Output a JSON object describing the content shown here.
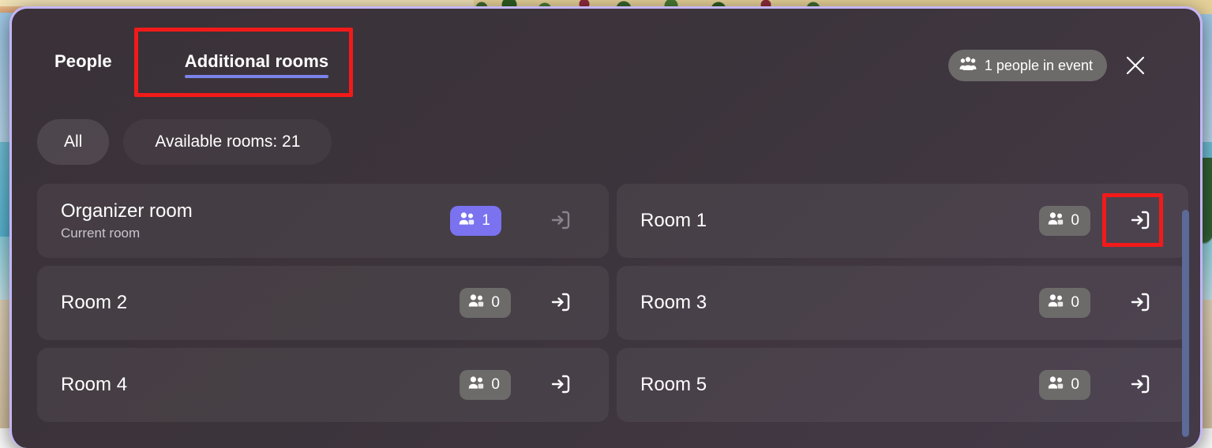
{
  "panel": {
    "accent_color": "#7b83eb",
    "badge_accent_color": "#7a72ef",
    "border_color": "#c4b5f5",
    "annotation_color": "#f21a1a"
  },
  "header": {
    "tabs": [
      {
        "label": "People",
        "selected": false
      },
      {
        "label": "Additional rooms",
        "selected": true
      }
    ],
    "event_count": {
      "icon": "people-group-icon",
      "label": "1 people in event"
    },
    "close_icon": "close-icon"
  },
  "filters": [
    {
      "label": "All",
      "selected": true
    },
    {
      "label": "Available rooms: 21",
      "selected": false
    }
  ],
  "rooms": [
    {
      "name": "Organizer room",
      "subtitle": "Current room",
      "count": "1",
      "count_style": "accent",
      "join_icon": "join-room-icon",
      "join_enabled": false
    },
    {
      "name": "Room 1",
      "subtitle": "",
      "count": "0",
      "count_style": "default",
      "join_icon": "join-room-icon",
      "join_enabled": true
    },
    {
      "name": "Room 2",
      "subtitle": "",
      "count": "0",
      "count_style": "default",
      "join_icon": "join-room-icon",
      "join_enabled": true
    },
    {
      "name": "Room 3",
      "subtitle": "",
      "count": "0",
      "count_style": "default",
      "join_icon": "join-room-icon",
      "join_enabled": true
    },
    {
      "name": "Room 4",
      "subtitle": "",
      "count": "0",
      "count_style": "default",
      "join_icon": "join-room-icon",
      "join_enabled": true
    },
    {
      "name": "Room 5",
      "subtitle": "",
      "count": "0",
      "count_style": "default",
      "join_icon": "join-room-icon",
      "join_enabled": true
    }
  ],
  "annotations": [
    {
      "target": "Additional rooms tab"
    },
    {
      "target": "Room 1 join button"
    }
  ]
}
